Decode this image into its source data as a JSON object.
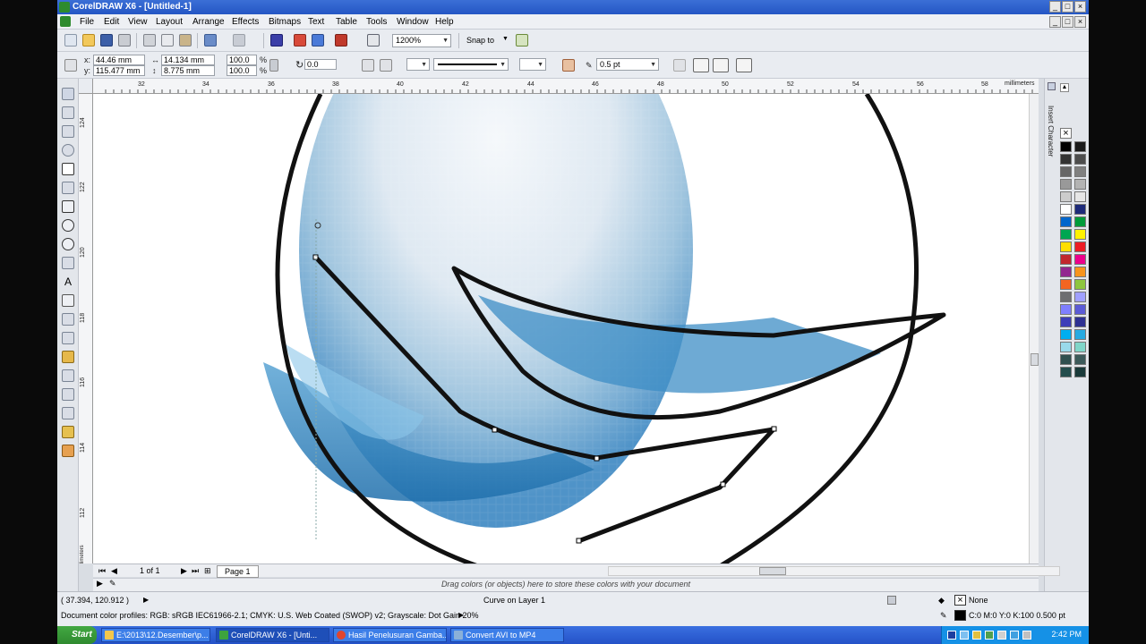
{
  "window": {
    "title": "CorelDRAW X6 - [Untitled-1]"
  },
  "menu": {
    "items": [
      {
        "label": "File"
      },
      {
        "label": "Edit"
      },
      {
        "label": "View"
      },
      {
        "label": "Layout"
      },
      {
        "label": "Arrange"
      },
      {
        "label": "Effects"
      },
      {
        "label": "Bitmaps"
      },
      {
        "label": "Text"
      },
      {
        "label": "Table"
      },
      {
        "label": "Tools"
      },
      {
        "label": "Window"
      },
      {
        "label": "Help"
      }
    ]
  },
  "toolbar": {
    "zoom": "1200%",
    "snap_label": "Snap to"
  },
  "properties": {
    "x_label": "x:",
    "x_value": "44.46 mm",
    "y_label": "y:",
    "y_value": "115.477 mm",
    "width_value": "14.134 mm",
    "height_value": "8.775 mm",
    "scale_x": "100.0",
    "scale_y": "100.0",
    "percent": "%",
    "rotation": "0.0",
    "outline_width": "0.5 pt"
  },
  "ruler": {
    "unit": "millimeters",
    "h_ticks": [
      "32",
      "34",
      "36",
      "38",
      "40",
      "42",
      "44",
      "46",
      "48",
      "50",
      "52",
      "54",
      "56",
      "58"
    ],
    "v_ticks": [
      "124",
      "122",
      "120",
      "118",
      "116",
      "114",
      "112"
    ],
    "v_unit": "millimeters"
  },
  "page_nav": {
    "count": "1 of 1",
    "page_tab": "Page 1"
  },
  "doc_palette": {
    "hint": "Drag colors (or objects) here to store these colors with your document"
  },
  "docker": {
    "label": "Insert Character"
  },
  "status": {
    "coords": "( 37.394, 120.912 )",
    "object_info": "Curve on Layer 1",
    "profiles": "Document color profiles: RGB: sRGB IEC61966-2.1; CMYK: U.S. Web Coated (SWOP) v2; Grayscale: Dot Gain 20%",
    "fill": "None",
    "outline": "C:0 M:0 Y:0 K:100  0.500 pt"
  },
  "palette": {
    "colors": [
      "#000000",
      "#1a1a1a",
      "#333333",
      "#4d4d4d",
      "#666666",
      "#808080",
      "#999999",
      "#b3b3b3",
      "#cccccc",
      "#e6e6e6",
      "#ffffff",
      "#1d2a7a",
      "#0066cc",
      "#009b3a",
      "#00a651",
      "#fff200",
      "#ffde00",
      "#ed1c24",
      "#c1272d",
      "#ec008c",
      "#92278f",
      "#f7941d",
      "#f26522",
      "#8dc63f",
      "#6d6e71",
      "#a0a0ff",
      "#7f7fff",
      "#5b5bd6",
      "#3d3db8",
      "#2e3192",
      "#00aeef",
      "#27aae1",
      "#99d9ea",
      "#7fd6c9",
      "#2f4f4f",
      "#3c5a5a",
      "#234d4d",
      "#1a3a3a"
    ]
  },
  "taskbar": {
    "start": "Start",
    "tasks": [
      {
        "label": "E:\\2013\\12.Desember\\p..."
      },
      {
        "label": "CorelDRAW X6 - [Unti..."
      },
      {
        "label": "Hasil Penelusuran Gamba..."
      },
      {
        "label": "Convert AVI to MP4"
      }
    ],
    "clock": "2:42 PM"
  }
}
